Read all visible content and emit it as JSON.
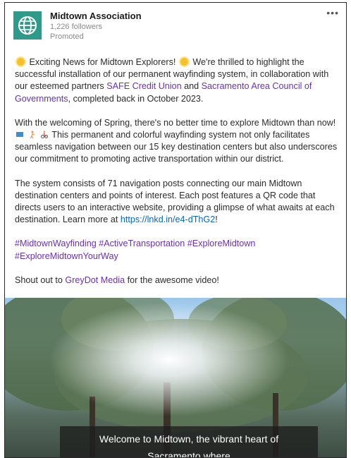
{
  "post": {
    "author": "Midtown Association",
    "followers": "1,226 followers",
    "promoted": "Promoted",
    "more_label": "•••"
  },
  "body": {
    "p1_part1": "Exciting News for Midtown Explorers!",
    "p1_part2": "We're thrilled to highlight the successful installation of our permanent wayfinding system, in collaboration with our esteemed partners ",
    "p1_link1": "SAFE Credit Union",
    "p1_and": " and ",
    "p1_link2": "Sacramento Area Council of Governments",
    "p1_end": ", completed back in October 2023.",
    "p2_start": "With the welcoming of Spring, there's no better time to explore Midtown than now!",
    "p2_end": " This permanent and colorful wayfinding system not only facilitates seamless navigation between our 15 key destination centers but also underscores our commitment to promoting active transportation within our district.",
    "p3": "The system consists of 71 navigation posts connecting our main Midtown destination centers and points of interest. Each post features a QR code that directs users to an interactive website, providing a glimpse of what awaits at each destination. Learn more at ",
    "p3_link": "https://lnkd.in/e4-dThG2",
    "p3_end": "!",
    "hashtags": [
      "#MidtownWayfinding",
      "#ActiveTransportation",
      "#ExploreMidtown",
      "#ExploreMidtownYourWay"
    ],
    "shout_start": "Shout out to ",
    "shout_link": "GreyDot Media",
    "shout_end": " for the awesome video!"
  },
  "video": {
    "caption_line1": "Welcome to Midtown, the vibrant heart of",
    "caption_line2": "Sacramento where"
  },
  "colors": {
    "logo": "#2f9a8a",
    "link": "#6b2fb8",
    "url": "#0a66c2"
  }
}
